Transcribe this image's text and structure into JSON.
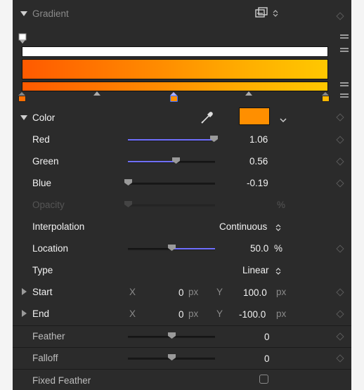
{
  "gradient": {
    "label": "Gradient"
  },
  "color": {
    "label": "Color",
    "swatch_hex": "#ff8f00",
    "red": {
      "label": "Red",
      "value": "1.06",
      "level": 0.98
    },
    "green": {
      "label": "Green",
      "value": "0.56",
      "level": 0.55
    },
    "blue": {
      "label": "Blue",
      "value": "-0.19",
      "level": 0.0
    },
    "opacity": {
      "label": "Opacity",
      "unit": "%"
    }
  },
  "interpolation": {
    "label": "Interpolation",
    "value": "Continuous"
  },
  "location": {
    "label": "Location",
    "value": "50.0",
    "unit": "%",
    "level": 0.5
  },
  "type": {
    "label": "Type",
    "value": "Linear"
  },
  "start": {
    "label": "Start",
    "x_label": "X",
    "x_value": "0",
    "x_unit": "px",
    "y_label": "Y",
    "y_value": "100.0",
    "y_unit": "px"
  },
  "end": {
    "label": "End",
    "x_label": "X",
    "x_value": "0",
    "x_unit": "px",
    "y_label": "Y",
    "y_value": "-100.0",
    "y_unit": "px"
  },
  "feather": {
    "label": "Feather",
    "value": "0",
    "level": 0.5
  },
  "falloff": {
    "label": "Falloff",
    "value": "0",
    "level": 0.5
  },
  "fixed_feather": {
    "label": "Fixed Feather",
    "checked": false
  },
  "colors": {
    "accent": "#6f6fff",
    "stop_orange": "#ff6f00",
    "stop_mid": "#3f6dff",
    "stop_end": "#ffb800"
  },
  "icons": [
    "disclosure-open-icon",
    "gradient-preset-icon",
    "stepper-icon",
    "keyframe-diamond-icon",
    "eyedropper-icon",
    "chevron-down-icon",
    "disclosure-closed-icon",
    "checkbox-icon"
  ]
}
